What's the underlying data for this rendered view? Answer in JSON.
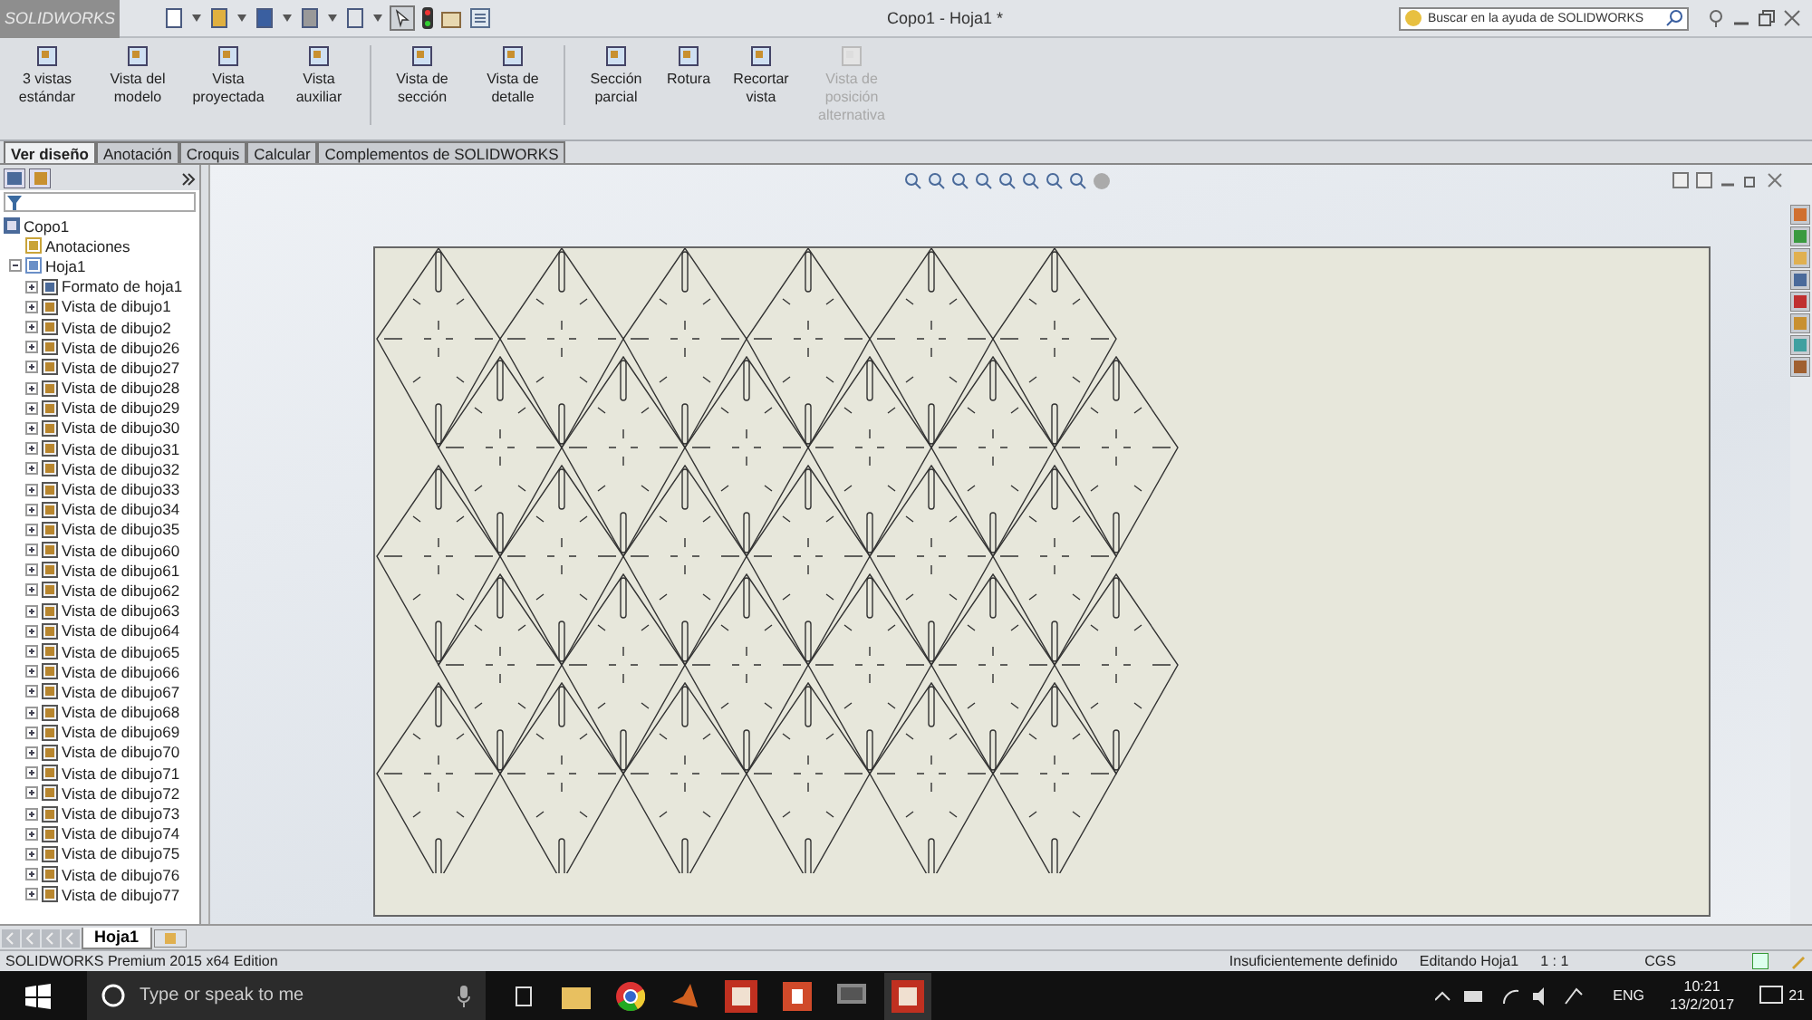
{
  "window": {
    "logo": "SOLIDWORKS",
    "title": "Copo1 - Hoja1 *"
  },
  "help_search": {
    "placeholder": "Buscar en la ayuda de SOLIDWORKS"
  },
  "ribbon": {
    "groups": [
      {
        "buttons": [
          {
            "label": "3 vistas estándar",
            "disabled": false
          },
          {
            "label": "Vista del modelo",
            "disabled": false
          },
          {
            "label": "Vista proyectada",
            "disabled": false
          },
          {
            "label": "Vista auxiliar",
            "disabled": false
          }
        ]
      },
      {
        "buttons": [
          {
            "label": "Vista de sección",
            "disabled": false
          },
          {
            "label": "Vista de detalle",
            "disabled": false
          }
        ]
      },
      {
        "buttons": [
          {
            "label": "Sección parcial",
            "disabled": false
          },
          {
            "label": "Rotura",
            "disabled": false
          },
          {
            "label": "Recortar vista",
            "disabled": false
          },
          {
            "label": "Vista de posición alternativa",
            "disabled": true
          }
        ]
      }
    ]
  },
  "tabs": [
    {
      "label": "Ver diseño",
      "selected": true
    },
    {
      "label": "Anotación",
      "selected": false
    },
    {
      "label": "Croquis",
      "selected": false
    },
    {
      "label": "Calcular",
      "selected": false
    },
    {
      "label": "Complementos de SOLIDWORKS",
      "selected": false
    }
  ],
  "tree": {
    "label": "Copo1",
    "children": [
      {
        "label": "Anotaciones",
        "kind": "annotations"
      },
      {
        "label": "Hoja1",
        "kind": "sheet",
        "expanded": true,
        "children": [
          {
            "label": "Formato de hoja1",
            "kind": "format",
            "expanded": false
          },
          {
            "label": "Vista de dibujo1",
            "kind": "view",
            "expanded": false
          },
          {
            "label": "Vista de dibujo2",
            "kind": "view",
            "expanded": false
          },
          {
            "label": "Vista de dibujo26",
            "kind": "view",
            "expanded": false
          },
          {
            "label": "Vista de dibujo27",
            "kind": "view",
            "expanded": false
          },
          {
            "label": "Vista de dibujo28",
            "kind": "view",
            "expanded": false
          },
          {
            "label": "Vista de dibujo29",
            "kind": "view",
            "expanded": false
          },
          {
            "label": "Vista de dibujo30",
            "kind": "view",
            "expanded": false
          },
          {
            "label": "Vista de dibujo31",
            "kind": "view",
            "expanded": false
          },
          {
            "label": "Vista de dibujo32",
            "kind": "view",
            "expanded": false
          },
          {
            "label": "Vista de dibujo33",
            "kind": "view",
            "expanded": false
          },
          {
            "label": "Vista de dibujo34",
            "kind": "view",
            "expanded": false
          },
          {
            "label": "Vista de dibujo35",
            "kind": "view",
            "expanded": false
          },
          {
            "label": "Vista de dibujo60",
            "kind": "view",
            "expanded": false
          },
          {
            "label": "Vista de dibujo61",
            "kind": "view",
            "expanded": false
          },
          {
            "label": "Vista de dibujo62",
            "kind": "view",
            "expanded": false
          },
          {
            "label": "Vista de dibujo63",
            "kind": "view",
            "expanded": false
          },
          {
            "label": "Vista de dibujo64",
            "kind": "view",
            "expanded": false
          },
          {
            "label": "Vista de dibujo65",
            "kind": "view",
            "expanded": false
          },
          {
            "label": "Vista de dibujo66",
            "kind": "view",
            "expanded": false
          },
          {
            "label": "Vista de dibujo67",
            "kind": "view",
            "expanded": false
          },
          {
            "label": "Vista de dibujo68",
            "kind": "view",
            "expanded": false
          },
          {
            "label": "Vista de dibujo69",
            "kind": "view",
            "expanded": false
          },
          {
            "label": "Vista de dibujo70",
            "kind": "view",
            "expanded": false
          },
          {
            "label": "Vista de dibujo71",
            "kind": "view",
            "expanded": false
          },
          {
            "label": "Vista de dibujo72",
            "kind": "view",
            "expanded": false
          },
          {
            "label": "Vista de dibujo73",
            "kind": "view",
            "expanded": false
          },
          {
            "label": "Vista de dibujo74",
            "kind": "view",
            "expanded": false
          },
          {
            "label": "Vista de dibujo75",
            "kind": "view",
            "expanded": false
          },
          {
            "label": "Vista de dibujo76",
            "kind": "view",
            "expanded": false
          },
          {
            "label": "Vista de dibujo77",
            "kind": "view",
            "expanded": false
          }
        ]
      }
    ]
  },
  "sheet_tabs": [
    {
      "label": "Hoja1",
      "selected": true
    }
  ],
  "status_bar": {
    "edition": "SOLIDWORKS Premium 2015 x64 Edition",
    "items": [
      "Insuficientemente definido",
      "Editando Hoja1",
      "1 : 1",
      "CGS"
    ]
  },
  "taskbar": {
    "search": {
      "placeholder": "Type or speak to me"
    },
    "language": "ENG",
    "time": "10:21",
    "date": "13/2/2017",
    "notifications": "21"
  }
}
